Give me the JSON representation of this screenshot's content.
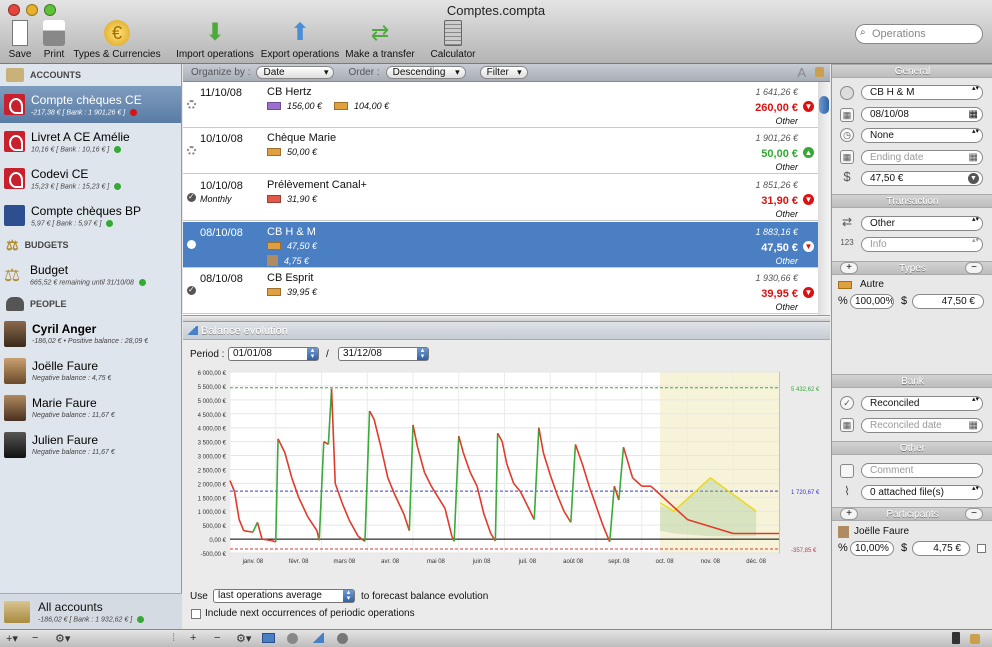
{
  "window": {
    "title": "Comptes.compta"
  },
  "toolbar": {
    "save": "Save",
    "print": "Print",
    "types": "Types & Currencies",
    "import": "Import operations",
    "export": "Export operations",
    "transfer": "Make a transfer",
    "calculator": "Calculator",
    "search_placeholder": "Operations"
  },
  "sidebar": {
    "accounts_header": "ACCOUNTS",
    "accounts": [
      {
        "name": "Compte chèques CE",
        "sub": "-217,38 € [ Bank : 1 901,26 € ]"
      },
      {
        "name": "Livret A CE Amélie",
        "sub": "10,16 € [ Bank : 10,16 € ]"
      },
      {
        "name": "Codevi CE",
        "sub": "15,23 € [ Bank : 15,23 € ]"
      },
      {
        "name": "Compte chèques BP",
        "sub": "5,97 € [ Bank : 5,97 € ]"
      }
    ],
    "budgets_header": "BUDGETS",
    "budgets": [
      {
        "name": "Budget",
        "sub": "665,52 € remaining until 31/10/08"
      }
    ],
    "people_header": "PEOPLE",
    "people": [
      {
        "name": "Cyril Anger",
        "sub": "-186,02 € • Positive balance : 28,09 €"
      },
      {
        "name": "Joëlle Faure",
        "sub": "Negative balance : 4,75 €"
      },
      {
        "name": "Marie Faure",
        "sub": "Negative balance : 11,67 €"
      },
      {
        "name": "Julien Faure",
        "sub": "Negative balance : 11,67 €"
      }
    ],
    "all_accounts": {
      "name": "All accounts",
      "sub": "-186,02 € [ Bank : 1 932,62 € ]"
    }
  },
  "filterbar": {
    "organize_label": "Organize by :",
    "organize_value": "Date",
    "order_label": "Order :",
    "order_value": "Descending",
    "filter": "Filter"
  },
  "operations": [
    {
      "date": "11/10/08",
      "recurrence": "",
      "name": "CB Hertz",
      "tags": [
        {
          "amount": "156,00 €",
          "color": "#9a6fd0"
        },
        {
          "amount": "104,00 €",
          "color": "#e0a040"
        }
      ],
      "balance": "1 641,26 €",
      "amount": "260,00 €",
      "category": "Other",
      "positive": false
    },
    {
      "date": "10/10/08",
      "recurrence": "",
      "name": "Chèque Marie",
      "tags": [
        {
          "amount": "50,00 €",
          "color": "#e0a040"
        }
      ],
      "balance": "1 901,26 €",
      "amount": "50,00 €",
      "category": "Other",
      "positive": true
    },
    {
      "date": "10/10/08",
      "recurrence": "Monthly",
      "name": "Prélèvement Canal+",
      "tags": [
        {
          "amount": "31,90 €",
          "color": "#e05a4a"
        }
      ],
      "balance": "1 851,26 €",
      "amount": "31,90 €",
      "category": "Other",
      "positive": false
    },
    {
      "date": "08/10/08",
      "recurrence": "",
      "name": "CB H & M",
      "tags": [
        {
          "amount": "47,50 €",
          "color": "#e0a040"
        }
      ],
      "extra": "4,75 €",
      "balance": "1 883,16 €",
      "amount": "47,50 €",
      "category": "Other",
      "positive": false
    },
    {
      "date": "08/10/08",
      "recurrence": "",
      "name": "CB Esprit",
      "tags": [
        {
          "amount": "39,95 €",
          "color": "#e0a040"
        }
      ],
      "balance": "1 930,66 €",
      "amount": "39,95 €",
      "category": "Other",
      "positive": false
    }
  ],
  "chart_section": {
    "title": "Balance evolution",
    "period_label": "Period :",
    "start": "01/01/08",
    "sep": "/",
    "end": "31/12/08"
  },
  "chart_data": {
    "type": "line",
    "y_ticks": [
      "6 000,00 €",
      "5 500,00 €",
      "5 000,00 €",
      "4 500,00 €",
      "4 000,00 €",
      "3 500,00 €",
      "3 000,00 €",
      "2 500,00 €",
      "2 000,00 €",
      "1 500,00 €",
      "1 000,00 €",
      "500,00 €",
      "0,00 €",
      "-500,00 €"
    ],
    "x_ticks": [
      "janv. 08",
      "févr. 08",
      "mars 08",
      "avr. 08",
      "mai 08",
      "juin 08",
      "juil. 08",
      "août 08",
      "sept. 08",
      "oct. 08",
      "nov. 08",
      "déc. 08"
    ],
    "ylim": [
      -500,
      6000
    ],
    "ref_lines": [
      {
        "value": 5432.62,
        "label": "5 432,62 €",
        "color": "#3aa83a"
      },
      {
        "value": 1720.67,
        "label": "1 720,67 €",
        "color": "#3a3ad0"
      },
      {
        "value": -357.85,
        "label": "-357,85 €",
        "color": "#d03a3a"
      }
    ],
    "forecast_start_month": 9.4,
    "series": [
      {
        "points": [
          [
            0,
            2100
          ],
          [
            0.1,
            1700
          ],
          [
            0.2,
            700
          ],
          [
            0.3,
            300
          ],
          [
            0.5,
            250
          ],
          [
            0.6,
            600
          ],
          [
            0.7,
            0
          ],
          [
            0.9,
            -50
          ],
          [
            1,
            -100
          ],
          [
            1.05,
            3600
          ],
          [
            1.2,
            3100
          ],
          [
            1.35,
            2200
          ],
          [
            1.5,
            1500
          ],
          [
            1.7,
            800
          ],
          [
            1.9,
            300
          ],
          [
            1.95,
            -50
          ],
          [
            2.05,
            3500
          ],
          [
            2.15,
            3400
          ],
          [
            2.22,
            5400
          ],
          [
            2.3,
            2000
          ],
          [
            2.45,
            1300
          ],
          [
            2.6,
            700
          ],
          [
            2.8,
            100
          ],
          [
            2.95,
            -80
          ],
          [
            3.05,
            4600
          ],
          [
            3.15,
            4300
          ],
          [
            3.3,
            3300
          ],
          [
            3.45,
            2200
          ],
          [
            3.6,
            1600
          ],
          [
            3.8,
            900
          ],
          [
            3.92,
            300
          ],
          [
            4.0,
            4100
          ],
          [
            4.1,
            3300
          ],
          [
            4.25,
            2400
          ],
          [
            4.4,
            1900
          ],
          [
            4.55,
            1500
          ],
          [
            4.7,
            1100
          ],
          [
            4.85,
            100
          ],
          [
            4.9,
            -80
          ],
          [
            5.0,
            3700
          ],
          [
            5.1,
            3100
          ],
          [
            5.25,
            2400
          ],
          [
            5.4,
            1900
          ],
          [
            5.55,
            900
          ],
          [
            5.7,
            200
          ],
          [
            5.8,
            -70
          ],
          [
            5.85,
            3800
          ],
          [
            5.95,
            3500
          ],
          [
            6.05,
            2700
          ],
          [
            6.2,
            2000
          ],
          [
            6.35,
            1700
          ],
          [
            6.5,
            1200
          ],
          [
            6.65,
            700
          ],
          [
            6.75,
            4000
          ],
          [
            6.85,
            3100
          ],
          [
            7.0,
            2300
          ],
          [
            7.15,
            1600
          ],
          [
            7.3,
            1000
          ],
          [
            7.45,
            600
          ],
          [
            7.55,
            3400
          ],
          [
            7.7,
            2700
          ],
          [
            7.85,
            1900
          ],
          [
            8.0,
            1200
          ],
          [
            8.15,
            500
          ],
          [
            8.3,
            -100
          ],
          [
            8.4,
            1900
          ],
          [
            8.5,
            1400
          ],
          [
            8.6,
            3300
          ],
          [
            8.8,
            2200
          ],
          [
            9.0,
            1900
          ],
          [
            9.2,
            1900
          ],
          [
            9.4,
            1600
          ],
          [
            10.0,
            700
          ],
          [
            11.0,
            200
          ],
          [
            12,
            200
          ]
        ]
      }
    ]
  },
  "forecast": {
    "use_label": "Use",
    "method": "last operations average",
    "suffix": "to forecast balance evolution",
    "include": "Include next occurrences of periodic operations"
  },
  "rpanel": {
    "general": "General",
    "name": "CB H & M",
    "date": "08/10/08",
    "repeat": "None",
    "ending_placeholder": "Ending date",
    "amount": "47,50 €",
    "transaction": "Transaction",
    "type": "Other",
    "info_placeholder": "Info",
    "types": "Types",
    "type_name": "Autre",
    "type_pct": "100,00%",
    "type_amt": "47,50 €",
    "bank": "Bank",
    "status": "Reconciled",
    "rec_placeholder": "Reconciled date",
    "other": "Other",
    "comment_placeholder": "Comment",
    "attached": "0 attached file(s)",
    "participants": "Participants",
    "participant": "Joëlle Faure",
    "part_pct": "10,00%",
    "part_amt": "4,75 €"
  }
}
